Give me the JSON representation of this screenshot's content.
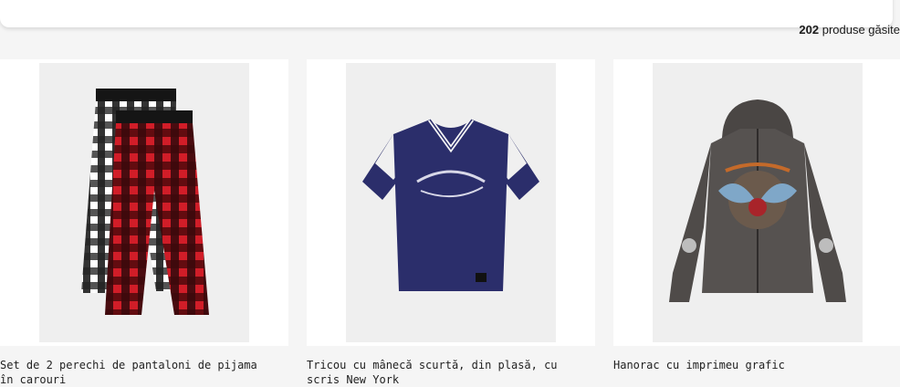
{
  "results": {
    "count": "202",
    "label": "produse găsite"
  },
  "products": [
    {
      "title": "Set de 2 perechi de pantaloni de pijama în carouri",
      "image": "plaid-pajama-pants"
    },
    {
      "title": "Tricou cu mânecă scurtă, din plasă, cu scris New York",
      "image": "navy-tshirt"
    },
    {
      "title": "Hanorac cu imprimeu grafic",
      "image": "grey-hoodie"
    }
  ],
  "colors": {
    "background": "#f5f5f5",
    "card": "#ffffff",
    "image_bg": "#efefef"
  }
}
